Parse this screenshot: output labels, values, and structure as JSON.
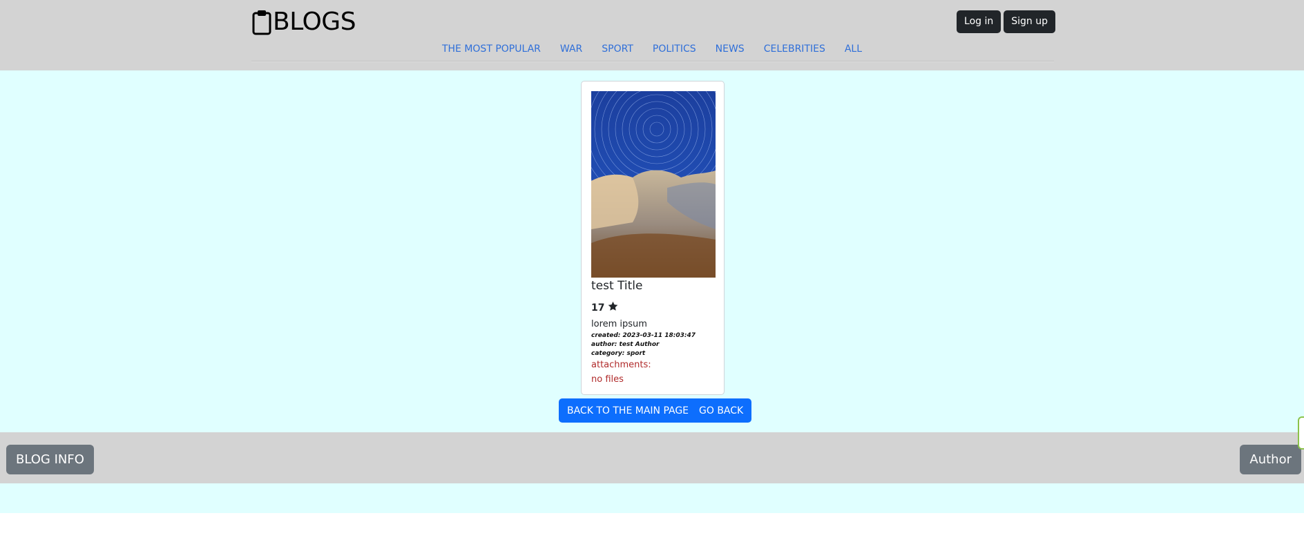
{
  "header": {
    "logo_text": "BLOGS",
    "login_label": "Log in",
    "signup_label": "Sign up",
    "nav": [
      {
        "label": "THE MOST POPULAR"
      },
      {
        "label": "WAR"
      },
      {
        "label": "SPORT"
      },
      {
        "label": "POLITICS"
      },
      {
        "label": "NEWS"
      },
      {
        "label": "CELEBRITIES"
      },
      {
        "label": "ALL"
      }
    ]
  },
  "card": {
    "title": "test Title",
    "rating": "17",
    "description": "lorem ipsum",
    "created": "created: 2023-03-11 18:03:47",
    "author": "author: test Author",
    "category": "category: sport",
    "attachments_label": "attachments:",
    "attachments_value": "no files"
  },
  "actions": {
    "back_main": "BACK TO THE MAIN PAGE",
    "go_back": "GO BACK"
  },
  "footer": {
    "blog_info": "BLOG INFO",
    "author": "Author"
  },
  "colors": {
    "header_bg": "#d3d3d3",
    "main_bg": "#e0ffff",
    "link": "#2f6fd9",
    "primary": "#0d6efd",
    "dark": "#212529",
    "secondary": "#6c757d",
    "danger_text": "#b02a2a"
  }
}
